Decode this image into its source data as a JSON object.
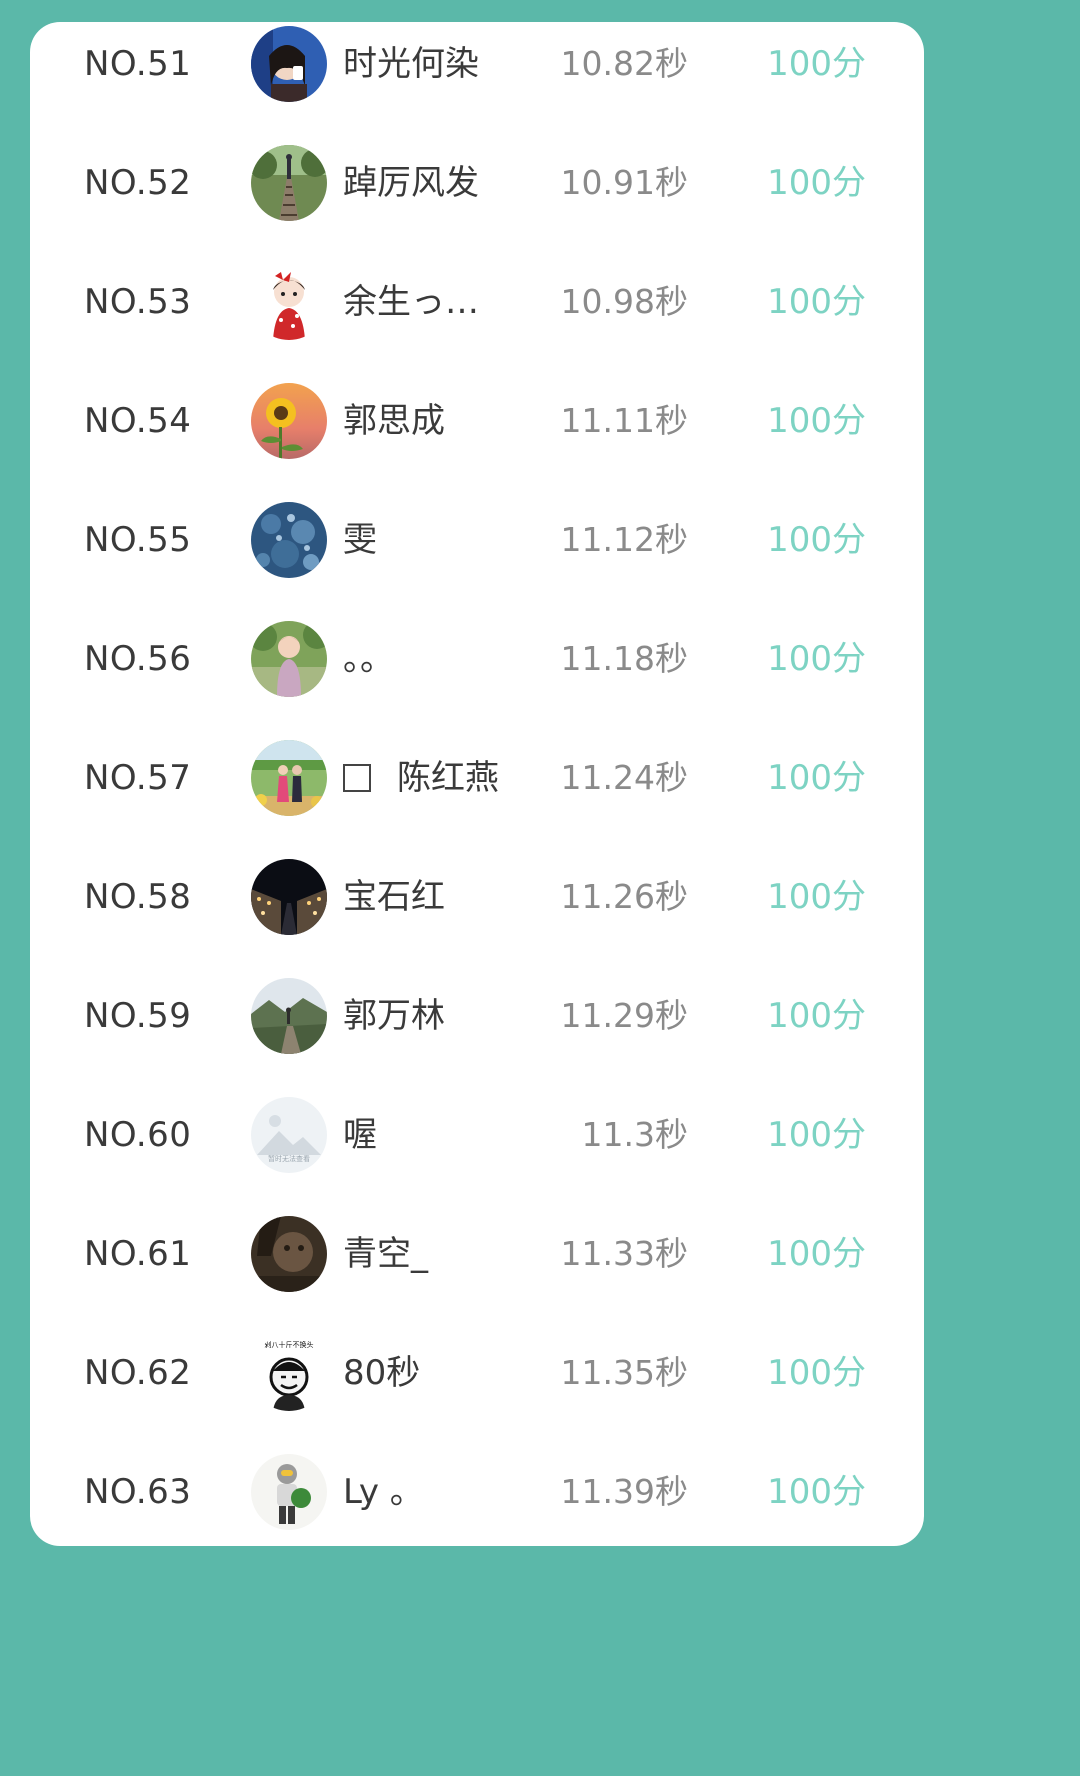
{
  "leaderboard": {
    "rows": [
      {
        "rank": "NO.51",
        "name": "时光何染",
        "time": "10.82秒",
        "score": "100分",
        "avatar": "girl-drinking-avatar"
      },
      {
        "rank": "NO.52",
        "name": "踔厉风发",
        "time": "10.91秒",
        "score": "100分",
        "avatar": "railway-track-avatar"
      },
      {
        "rank": "NO.53",
        "name": "余生っ…",
        "time": "10.98秒",
        "score": "100分",
        "avatar": "cartoon-girl-avatar"
      },
      {
        "rank": "NO.54",
        "name": "郭思成",
        "time": "11.11秒",
        "score": "100分",
        "avatar": "sunflower-avatar"
      },
      {
        "rank": "NO.55",
        "name": "雯",
        "time": "11.12秒",
        "score": "100分",
        "avatar": "blue-texture-avatar"
      },
      {
        "rank": "NO.56",
        "name": "。。",
        "time": "11.18秒",
        "score": "100分",
        "avatar": "toddler-photo-avatar"
      },
      {
        "rank": "NO.57",
        "name": "陈红燕",
        "time": "11.24秒",
        "score": "100分",
        "avatar": "couple-garden-avatar",
        "has_box": true
      },
      {
        "rank": "NO.58",
        "name": "宝石红",
        "time": "11.26秒",
        "score": "100分",
        "avatar": "night-street-avatar"
      },
      {
        "rank": "NO.59",
        "name": "郭万林",
        "time": "11.29秒",
        "score": "100分",
        "avatar": "mountain-path-avatar"
      },
      {
        "rank": "NO.60",
        "name": "喔",
        "time": "11.3秒",
        "score": "100分",
        "avatar": "placeholder-image-avatar",
        "avatar_caption": "暂时无法查看"
      },
      {
        "rank": "NO.61",
        "name": "青空_",
        "time": "11.33秒",
        "score": "100分",
        "avatar": "dark-portrait-avatar"
      },
      {
        "rank": "NO.62",
        "name": "80秒",
        "time": "11.35秒",
        "score": "100分",
        "avatar": "meme-face-avatar",
        "avatar_caption": "剁八十斤不换头"
      },
      {
        "rank": "NO.63",
        "name": "Ly 。",
        "time": "11.39秒",
        "score": "100分",
        "avatar": "toy-figure-avatar"
      }
    ]
  },
  "colors": {
    "background": "#5bb8a9",
    "card": "#ffffff",
    "rank_text": "#3a3a3a",
    "time_text": "#8a8a8a",
    "score_text": "#7dd3c3"
  }
}
